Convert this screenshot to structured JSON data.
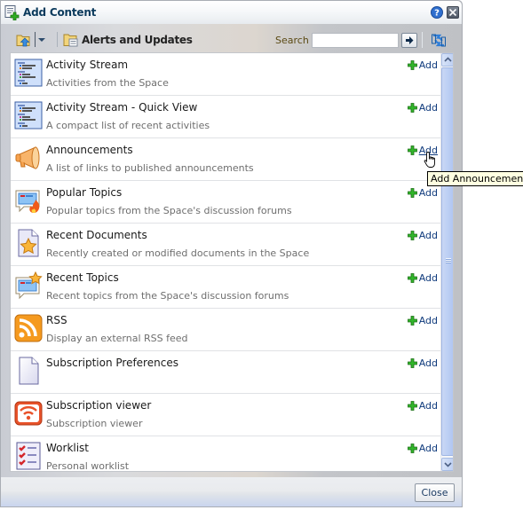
{
  "dialog": {
    "title": "Add Content",
    "help_icon": "help-icon",
    "close_icon": "close-icon"
  },
  "toolbar": {
    "folder_up_icon": "folder-up-icon",
    "dropdown_icon": "chevron-down-icon",
    "current_folder_icon": "folder-icon",
    "current_folder": "Alerts and Updates",
    "search_label": "Search",
    "search_value": "",
    "search_placeholder": "",
    "go_icon": "arrow-right-icon",
    "refresh_icon": "refresh-icon"
  },
  "items": [
    {
      "name": "Activity Stream",
      "description": "Activities from the Space",
      "icon": "activity-stream-icon",
      "add_label": "Add"
    },
    {
      "name": "Activity Stream - Quick View",
      "description": "A compact list of recent activities",
      "icon": "activity-stream-icon",
      "add_label": "Add"
    },
    {
      "name": "Announcements",
      "description": "A list of links to published announcements",
      "icon": "megaphone-icon",
      "add_label": "Add"
    },
    {
      "name": "Popular Topics",
      "description": "Popular topics from the Space's discussion forums",
      "icon": "popular-topics-icon",
      "add_label": "Add"
    },
    {
      "name": "Recent Documents",
      "description": "Recently created or modified documents in the Space",
      "icon": "recent-documents-icon",
      "add_label": "Add"
    },
    {
      "name": "Recent Topics",
      "description": "Recent topics from the Space's discussion forums",
      "icon": "recent-topics-icon",
      "add_label": "Add"
    },
    {
      "name": "RSS",
      "description": "Display an external RSS feed",
      "icon": "rss-icon",
      "add_label": "Add"
    },
    {
      "name": "Subscription Preferences",
      "description": "",
      "icon": "document-icon",
      "add_label": "Add"
    },
    {
      "name": "Subscription viewer",
      "description": "Subscription viewer",
      "icon": "subscription-icon",
      "add_label": "Add"
    },
    {
      "name": "Worklist",
      "description": "Personal worklist",
      "icon": "worklist-icon",
      "add_label": "Add"
    }
  ],
  "tooltip": "Add Announcements",
  "footer": {
    "close_label": "Close"
  },
  "colors": {
    "title": "#0b3a5c",
    "link": "#0f3a7c",
    "tooltip_bg": "#ffffe1"
  }
}
